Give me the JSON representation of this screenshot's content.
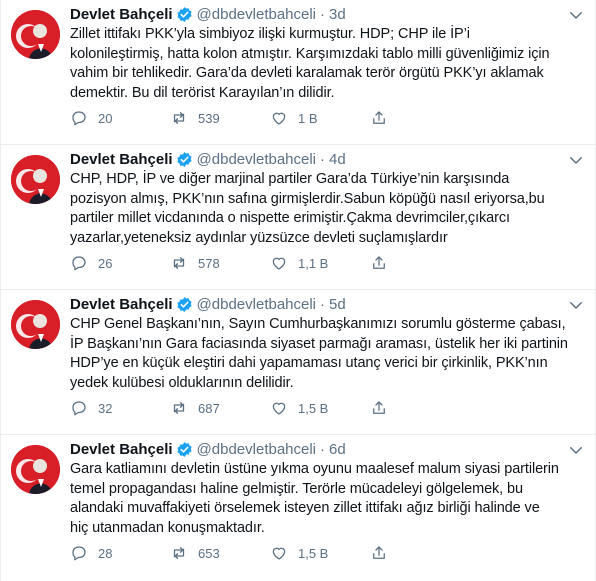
{
  "colors": {
    "verified": "#1da1f2",
    "secondary_text": "#5b7083",
    "avatar_bg": "#d81e27",
    "divider": "#ebeef0"
  },
  "tweets": [
    {
      "name": "Devlet Bahçeli",
      "handle": "@dbdevletbahceli",
      "dot": "·",
      "time": "3d",
      "text": "Zillet ittifakı PKK’yla simbiyoz ilişki kurmuştur. HDP; CHP ile İP’i\nkolonileştirmiş, hatta kolon atmıştır. Karşımızdaki tablo milli güvenliğimiz için\nvahim bir tehlikedir. Gara’da devleti karalamak terör örgütü PKK’yı aklamak\ndemektir. Bu dil terörist Karayılan’ın dilidir.",
      "replies": "20",
      "retweets": "539",
      "likes": "1 B"
    },
    {
      "name": "Devlet Bahçeli",
      "handle": "@dbdevletbahceli",
      "dot": "·",
      "time": "4d",
      "text": "CHP, HDP, İP ve diğer marjinal partiler Gara’da Türkiye’nin karşısında\npozisyon almış, PKK’nın safına girmişlerdir.Sabun köpüğü nasıl eriyorsa,bu\npartiler millet vicdanında o nispette erimiştir.Çakma devrimciler,çıkarcı\nyazarlar,yeteneksiz aydınlar yüzsüzce devleti suçlamışlardır",
      "replies": "26",
      "retweets": "578",
      "likes": "1,1 B"
    },
    {
      "name": "Devlet Bahçeli",
      "handle": "@dbdevletbahceli",
      "dot": "·",
      "time": "5d",
      "text": "CHP Genel Başkanı’nın, Sayın Cumhurbaşkanımızı sorumlu gösterme çabası,\nİP Başkanı’nın Gara faciasında siyaset parmağı araması, üstelik her iki partinin\nHDP’ye en küçük eleştiri dahi yapamaması utanç verici bir çirkinlik, PKK’nın\nyedek kulübesi olduklarının delilidir.",
      "replies": "32",
      "retweets": "687",
      "likes": "1,5 B"
    },
    {
      "name": "Devlet Bahçeli",
      "handle": "@dbdevletbahceli",
      "dot": "·",
      "time": "6d",
      "text": "Gara katliamını devletin üstüne yıkma oyunu maalesef malum siyasi partilerin\ntemel propagandası haline gelmiştir. Terörle mücadeleyi gölgelemek, bu\nalandaki muvaffakiyeti örselemek isteyen zillet ittifakı ağız birliği halinde ve\nhiç utanmadan konuşmaktadır.",
      "replies": "28",
      "retweets": "653",
      "likes": "1,5 B"
    }
  ]
}
